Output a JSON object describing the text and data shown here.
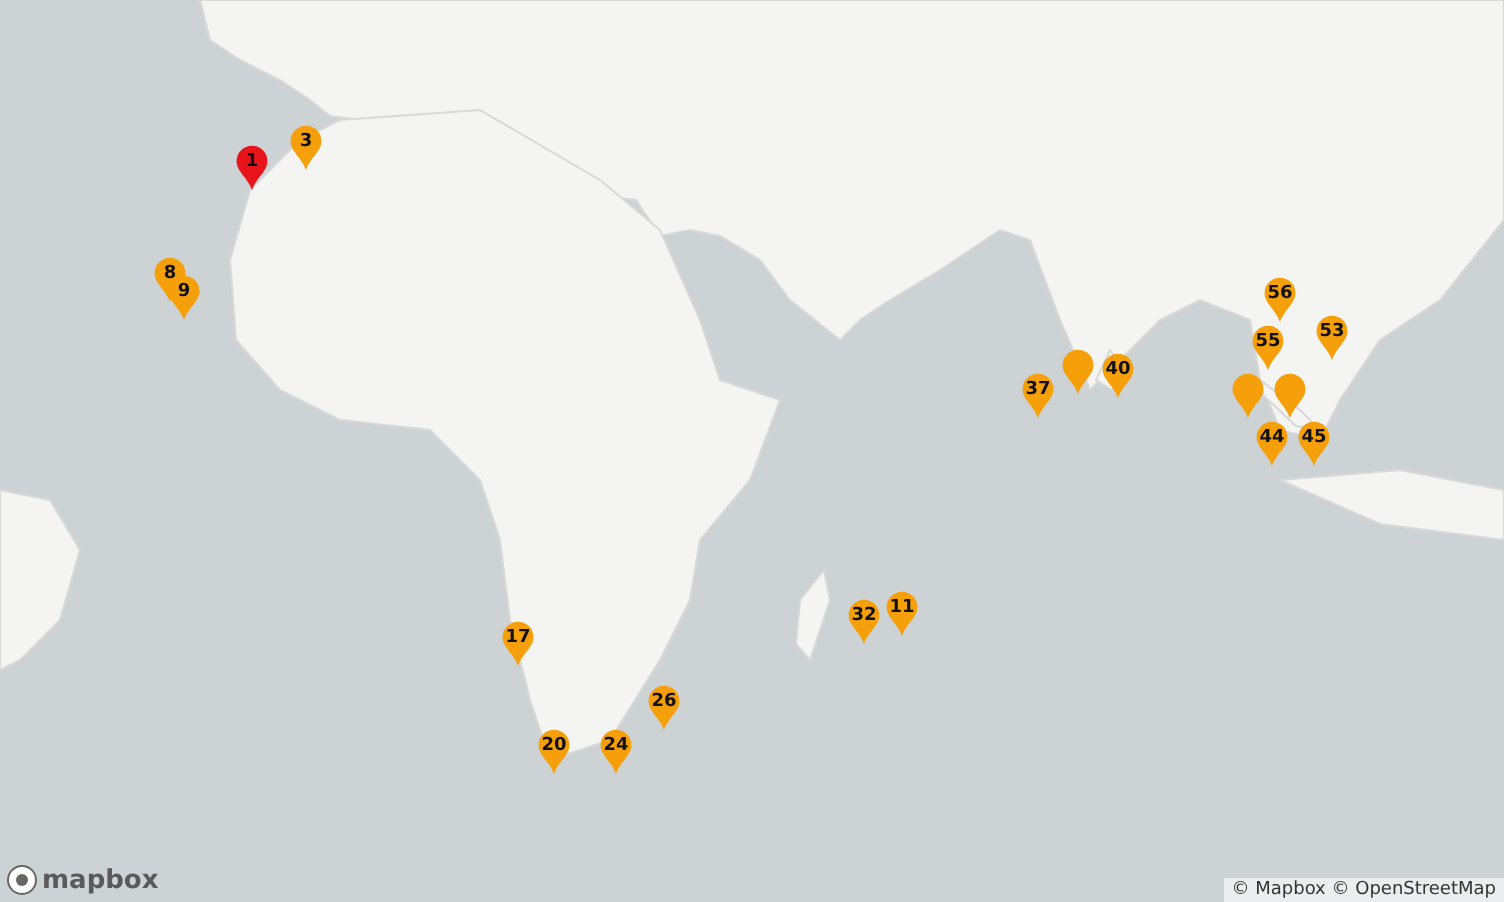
{
  "map": {
    "markers": [
      {
        "label": "1",
        "color": "#e8141c"
      },
      {
        "label": "3",
        "color": "#f5a00a"
      },
      {
        "label": "8",
        "color": "#f5a00a"
      },
      {
        "label": "9",
        "color": "#f5a00a"
      },
      {
        "label": "17",
        "color": "#f5a00a"
      },
      {
        "label": "20",
        "color": "#f5a00a"
      },
      {
        "label": "24",
        "color": "#f5a00a"
      },
      {
        "label": "26",
        "color": "#f5a00a"
      },
      {
        "label": "11",
        "color": "#f5a00a"
      },
      {
        "label": "32",
        "color": "#f5a00a"
      },
      {
        "label": "37",
        "color": "#f5a00a"
      },
      {
        "color": "#f5a00a"
      },
      {
        "label": "40",
        "color": "#f5a00a"
      },
      {
        "label": "56",
        "color": "#f5a00a"
      },
      {
        "label": "55",
        "color": "#f5a00a"
      },
      {
        "label": "53",
        "color": "#f5a00a"
      },
      {
        "color": "#f5a00a"
      },
      {
        "color": "#f5a00a"
      },
      {
        "label": "44",
        "color": "#f5a00a"
      },
      {
        "label": "45",
        "color": "#f5a00a"
      }
    ]
  },
  "logo": {
    "text": "mapbox"
  },
  "attribution": "© Mapbox © OpenStreetMap"
}
